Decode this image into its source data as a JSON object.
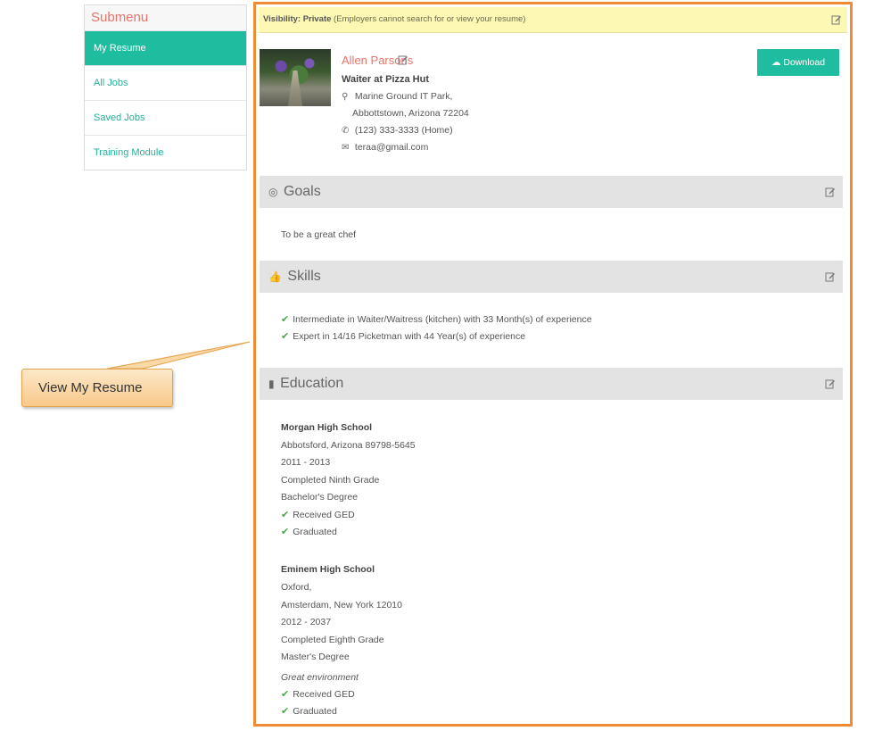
{
  "submenu": {
    "title": "Submenu",
    "items": [
      {
        "label": "My Resume",
        "active": true
      },
      {
        "label": "All Jobs"
      },
      {
        "label": "Saved Jobs"
      },
      {
        "label": "Training Module"
      }
    ]
  },
  "callout": {
    "label": "View My Resume"
  },
  "visibility": {
    "label": "Visibility: Private",
    "note": "(Employers cannot search for or view your resume)"
  },
  "profile": {
    "name": "Allen Parsons",
    "title": "Waiter at Pizza Hut",
    "address_line1": "Marine Ground IT Park,",
    "address_line2": "Abbottstown, Arizona  72204",
    "phone": "(123) 333-3333 (Home)",
    "email": "teraa@gmail.com"
  },
  "download_button": "Download Resume",
  "goals": {
    "heading": "Goals",
    "text": "To be a great chef"
  },
  "skills": {
    "heading": "Skills",
    "items": [
      "Intermediate in Waiter/Waitress (kitchen) with 33  Month(s) of experience",
      "Expert in 14/16 Picketman with 44  Year(s) of experience"
    ]
  },
  "education": {
    "heading": "Education",
    "schools": [
      {
        "name": "Morgan High School",
        "address": "Abbotsford, Arizona  89798-5645",
        "years": "2011 - 2013",
        "completed": "Completed Ninth Grade",
        "degree": "Bachelor's Degree",
        "checks": [
          "Received GED",
          "Graduated"
        ]
      },
      {
        "name": "Eminem High School",
        "address_line1": "Oxford,",
        "address_line2": "Amsterdam, New York  12010",
        "years": "2012 - 2037",
        "completed": "Completed Eighth Grade",
        "degree": "Master's Degree",
        "note": "Great environment",
        "checks": [
          "Received GED",
          "Graduated"
        ]
      }
    ]
  },
  "colors": {
    "accent": "#1fbd9f",
    "name": "#e8736a",
    "frame": "#f08a33",
    "visibility_bg": "#fdf8b4"
  }
}
